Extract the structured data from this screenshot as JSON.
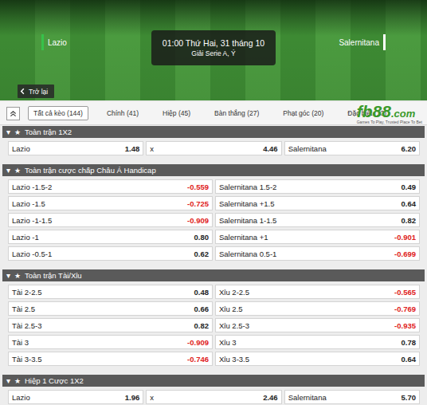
{
  "match": {
    "home": "Lazio",
    "away": "Salernitana",
    "home_color": "#37c24a",
    "away_color": "#ffffff",
    "time": "01:00 Thứ Hai, 31 tháng 10",
    "league": "Giải Serie A, Ý",
    "back": "Trở lại"
  },
  "tabs": [
    {
      "label": "Tất cả kèo (144)",
      "selected": true
    },
    {
      "label": "Chính (41)",
      "selected": false
    },
    {
      "label": "Hiệp (45)",
      "selected": false
    },
    {
      "label": "Bàn thắng (27)",
      "selected": false
    },
    {
      "label": "Phạt góc (20)",
      "selected": false
    },
    {
      "label": "Đặc biệt (13)",
      "selected": false
    }
  ],
  "logo": {
    "name": "fb88",
    "domain": ".com",
    "tagline": "Games To Play, Trusted Place To Bet"
  },
  "markets": [
    {
      "toggle": "▾",
      "star": "★",
      "title": "Toàn trận 1X2",
      "expanded": true,
      "rows": [
        [
          {
            "label": "Lazio",
            "odd": "1.48",
            "negative": false
          },
          {
            "label": "x",
            "odd": "4.46",
            "negative": false
          },
          {
            "label": "Salernitana",
            "odd": "6.20",
            "negative": false
          }
        ]
      ]
    },
    {
      "toggle": "▾",
      "star": "★",
      "title": "Toàn trận cược chấp Châu Á Handicap",
      "expanded": true,
      "rows": [
        [
          {
            "label": "Lazio -1.5-2",
            "odd": "-0.559",
            "negative": true
          },
          {
            "label": "Salernitana 1.5-2",
            "odd": "0.49",
            "negative": false
          }
        ],
        [
          {
            "label": "Lazio -1.5",
            "odd": "-0.725",
            "negative": true
          },
          {
            "label": "Salernitana +1.5",
            "odd": "0.64",
            "negative": false
          }
        ],
        [
          {
            "label": "Lazio -1-1.5",
            "odd": "-0.909",
            "negative": true
          },
          {
            "label": "Salernitana 1-1.5",
            "odd": "0.82",
            "negative": false
          }
        ],
        [
          {
            "label": "Lazio -1",
            "odd": "0.80",
            "negative": false
          },
          {
            "label": "Salernitana +1",
            "odd": "-0.901",
            "negative": true
          }
        ],
        [
          {
            "label": "Lazio -0.5-1",
            "odd": "0.62",
            "negative": false
          },
          {
            "label": "Salernitana 0.5-1",
            "odd": "-0.699",
            "negative": true
          }
        ]
      ]
    },
    {
      "toggle": "▾",
      "star": "★",
      "title": "Toàn trận Tài/Xỉu",
      "expanded": true,
      "rows": [
        [
          {
            "label": "Tài 2-2.5",
            "odd": "0.48",
            "negative": false
          },
          {
            "label": "Xỉu 2-2.5",
            "odd": "-0.565",
            "negative": true
          }
        ],
        [
          {
            "label": "Tài 2.5",
            "odd": "0.66",
            "negative": false
          },
          {
            "label": "Xỉu 2.5",
            "odd": "-0.769",
            "negative": true
          }
        ],
        [
          {
            "label": "Tài 2.5-3",
            "odd": "0.82",
            "negative": false
          },
          {
            "label": "Xỉu 2.5-3",
            "odd": "-0.935",
            "negative": true
          }
        ],
        [
          {
            "label": "Tài 3",
            "odd": "-0.909",
            "negative": true
          },
          {
            "label": "Xỉu 3",
            "odd": "0.78",
            "negative": false
          }
        ],
        [
          {
            "label": "Tài 3-3.5",
            "odd": "-0.746",
            "negative": true
          },
          {
            "label": "Xỉu 3-3.5",
            "odd": "0.64",
            "negative": false
          }
        ]
      ]
    },
    {
      "toggle": "▾",
      "star": "★",
      "title": "Hiệp 1 Cược 1X2",
      "expanded": true,
      "rows": [
        [
          {
            "label": "Lazio",
            "odd": "1.96",
            "negative": false
          },
          {
            "label": "x",
            "odd": "2.46",
            "negative": false
          },
          {
            "label": "Salernitana",
            "odd": "5.70",
            "negative": false
          }
        ]
      ]
    }
  ]
}
